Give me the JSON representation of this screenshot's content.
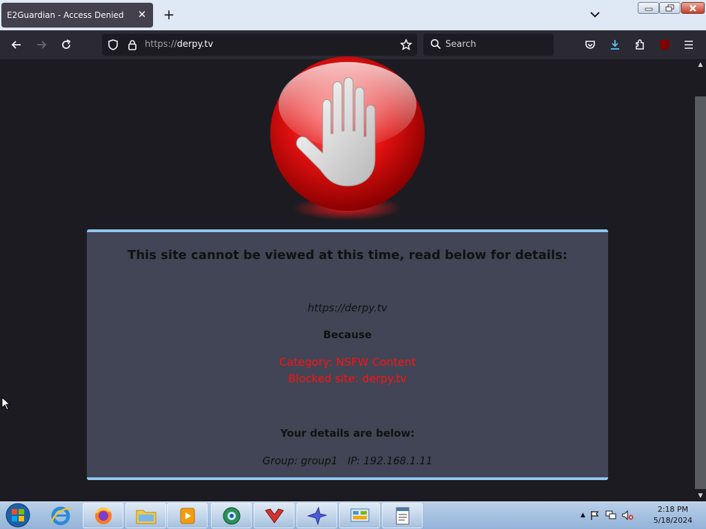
{
  "browser": {
    "tab": {
      "title": "E2Guardian - Access Denied",
      "close_glyph": "✕"
    },
    "new_tab_glyph": "+",
    "url": {
      "protocol": "https://",
      "host": "derpy.tv"
    },
    "search": {
      "placeholder": "Search"
    },
    "icons": [
      "back-icon",
      "forward-icon",
      "reload-icon",
      "shield-icon",
      "lock-icon",
      "star-icon",
      "search-icon",
      "pocket-icon",
      "download-icon",
      "extensions-icon",
      "ublock-icon",
      "menu-icon"
    ],
    "ublock_badge": "uo"
  },
  "page": {
    "headline": "This site cannot be viewed at this time, read below for details:",
    "blocked_url": "https://derpy.tv",
    "because": "Because",
    "reason_category": "Category: NSFW Content",
    "reason_site": "Blocked site: derpy.tv",
    "details_heading": "Your details are below:",
    "details_info": "Group: group1   IP: 192.168.1.11",
    "colors": {
      "panel_bg": "#414555",
      "panel_border": "#8ec7ef",
      "reason": "#ff1010",
      "sign": "#e01010"
    }
  },
  "taskbar": {
    "apps": [
      "windows-start-icon",
      "internet-explorer-icon",
      "firefox-icon",
      "file-explorer-icon",
      "media-player-icon",
      "network-globe-icon",
      "gauntlet-app-icon",
      "bird-app-icon",
      "control-panel-icon",
      "notepad-icon"
    ],
    "clock": {
      "time": "2:18 PM",
      "date": "5/18/2024"
    }
  }
}
